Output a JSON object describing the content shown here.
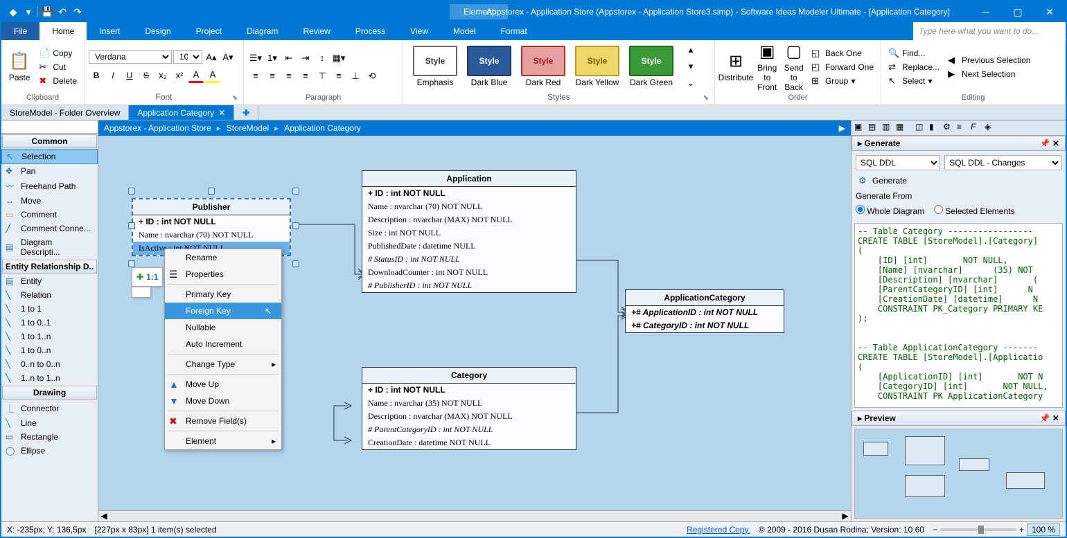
{
  "title": "Appstorex - Application Store (Appstorex - Application Store3.simp)  - Software Ideas Modeler Ultimate - [Application Category]",
  "context_tab": "Element",
  "search_placeholder": "Type here what you want to do...",
  "menus": {
    "file": "File",
    "home": "Home",
    "insert": "Insert",
    "design": "Design",
    "project": "Project",
    "diagram": "Diagram",
    "review": "Review",
    "process": "Process",
    "view": "View",
    "model": "Model",
    "format": "Format"
  },
  "ribbon": {
    "clipboard": {
      "paste": "Paste",
      "copy": "Copy",
      "cut": "Cut",
      "delete": "Delete",
      "label": "Clipboard"
    },
    "font": {
      "family": "Verdana",
      "size": "10",
      "label": "Font"
    },
    "paragraph": {
      "label": "Paragraph"
    },
    "styles": {
      "label": "Styles",
      "emphasis": "Emphasis",
      "darkblue": "Dark Blue",
      "darkred": "Dark Red",
      "darkyellow": "Dark Yellow",
      "darkgreen": "Dark Green",
      "style": "Style"
    },
    "order": {
      "distribute": "Distribute",
      "bring_front": "Bring to Front",
      "send_back": "Send to Back",
      "back_one": "Back One",
      "forward_one": "Forward One",
      "group": "Group",
      "label": "Order"
    },
    "editing": {
      "find": "Find...",
      "replace": "Replace...",
      "select": "Select",
      "prev": "Previous Selection",
      "next": "Next Selection",
      "label": "Editing"
    }
  },
  "tabs": {
    "overview": "StoreModel - Folder Overview",
    "active": "Application Category"
  },
  "breadcrumb": [
    "Appstorex - Application Store",
    "StoreModel",
    "Application Category"
  ],
  "toolbox": {
    "common": "Common",
    "common_items": [
      "Selection",
      "Pan",
      "Freehand Path",
      "Move",
      "Comment",
      "Comment Conne...",
      "Diagram Descripti..."
    ],
    "erd": "Entity Relationship D..",
    "erd_items": [
      "Entity",
      "Relation",
      "1 to 1",
      "1 to 0..1",
      "1 to 1..n",
      "1 to 0..n",
      "0..n to 0..n",
      "1..n to 1..n"
    ],
    "drawing": "Drawing",
    "drawing_items": [
      "Connector",
      "Line",
      "Rectangle",
      "Ellipse"
    ]
  },
  "entities": {
    "publisher": {
      "name": "Publisher",
      "rows": [
        "+ ID : int NOT NULL",
        "Name : nvarchar (70)  NOT NULL",
        "IsActive : int NOT NULL"
      ]
    },
    "application": {
      "name": "Application",
      "rows": [
        "+ ID : int NOT NULL",
        "Name : nvarchar (70)  NOT NULL",
        "Description : nvarchar (MAX)  NOT NULL",
        "Size : int NOT NULL",
        "PublishedDate : datetime NULL",
        "# StatusID : int NOT NULL",
        "DownloadCounter : int NOT NULL",
        "# PublisherID : int NOT NULL"
      ]
    },
    "appcat": {
      "name": "ApplicationCategory",
      "rows": [
        "+# ApplicationID : int NOT NULL",
        "+# CategoryID : int NOT NULL"
      ]
    },
    "category": {
      "name": "Category",
      "rows": [
        "+ ID : int NOT NULL",
        "Name : nvarchar (35)  NOT NULL",
        "Description : nvarchar (MAX)  NOT NULL",
        "# ParentCategoryID : int NOT NULL",
        "CreationDate : datetime NOT NULL"
      ]
    }
  },
  "floater": "1:1",
  "context_menu": {
    "rename": "Rename",
    "properties": "Properties",
    "primary": "Primary Key",
    "foreign": "Foreign Key",
    "nullable": "Nullable",
    "autoinc": "Auto Increment",
    "changetype": "Change Type",
    "moveup": "Move Up",
    "movedown": "Move Down",
    "remove": "Remove Field(s)",
    "element": "Element"
  },
  "generate": {
    "title": "Generate",
    "action": "Generate",
    "from": "Generate From",
    "whole": "Whole Diagram",
    "selected": "Selected Elements",
    "src1": "SQL DDL",
    "src2": "SQL DDL - Changes",
    "sql": "-- Table Category -----------------\nCREATE TABLE [StoreModel].[Category]\n(\n    [ID] [int]       NOT NULL,\n    [Name] [nvarchar]      (35) NOT\n    [Description] [nvarchar]       (\n    [ParentCategoryID] [int]      N\n    [CreationDate] [datetime]      N\n    CONSTRAINT PK_Category PRIMARY KE\n);\n\n\n-- Table ApplicationCategory -------\nCREATE TABLE [StoreModel].[Applicatio\n(\n    [ApplicationID] [int]       NOT N\n    [CategoryID] [int]       NOT NULL,\n    CONSTRAINT PK ApplicationCategory"
  },
  "preview": "Preview",
  "status": {
    "coords": "X: -235px; Y: 136,5px",
    "sel": "[227px x 83px] 1 item(s) selected",
    "reg": "Registered Copy.",
    "copyright": "© 2009 - 2016 Dusan Rodina; Version: 10.60",
    "zoom": "100 %"
  }
}
